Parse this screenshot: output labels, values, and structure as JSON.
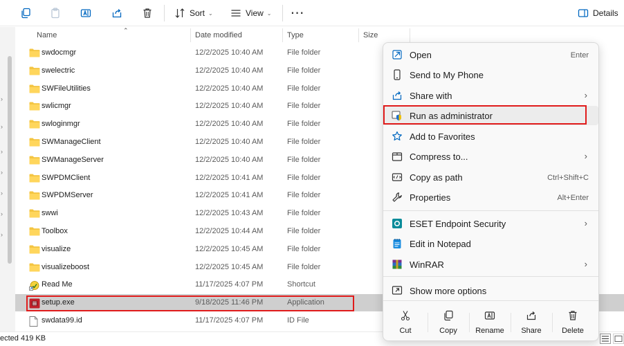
{
  "toolbar": {
    "sort_label": "Sort",
    "view_label": "View",
    "details_label": "Details",
    "icons": [
      "copy-icon",
      "paste-icon",
      "rename-icon",
      "share-icon",
      "delete-icon",
      "sort-icon",
      "view-icon",
      "more-icon",
      "details-pane-icon"
    ]
  },
  "columns": {
    "name": "Name",
    "date": "Date modified",
    "type": "Type",
    "size": "Size"
  },
  "files": [
    {
      "name": "swdocmgr",
      "date": "12/2/2025 10:40 AM",
      "type": "File folder",
      "icon": "folder"
    },
    {
      "name": "swelectric",
      "date": "12/2/2025 10:40 AM",
      "type": "File folder",
      "icon": "folder"
    },
    {
      "name": "SWFileUtilities",
      "date": "12/2/2025 10:40 AM",
      "type": "File folder",
      "icon": "folder"
    },
    {
      "name": "swlicmgr",
      "date": "12/2/2025 10:40 AM",
      "type": "File folder",
      "icon": "folder"
    },
    {
      "name": "swloginmgr",
      "date": "12/2/2025 10:40 AM",
      "type": "File folder",
      "icon": "folder"
    },
    {
      "name": "SWManageClient",
      "date": "12/2/2025 10:40 AM",
      "type": "File folder",
      "icon": "folder"
    },
    {
      "name": "SWManageServer",
      "date": "12/2/2025 10:40 AM",
      "type": "File folder",
      "icon": "folder"
    },
    {
      "name": "SWPDMClient",
      "date": "12/2/2025 10:41 AM",
      "type": "File folder",
      "icon": "folder"
    },
    {
      "name": "SWPDMServer",
      "date": "12/2/2025 10:41 AM",
      "type": "File folder",
      "icon": "folder"
    },
    {
      "name": "swwi",
      "date": "12/2/2025 10:43 AM",
      "type": "File folder",
      "icon": "folder"
    },
    {
      "name": "Toolbox",
      "date": "12/2/2025 10:44 AM",
      "type": "File folder",
      "icon": "folder"
    },
    {
      "name": "visualize",
      "date": "12/2/2025 10:45 AM",
      "type": "File folder",
      "icon": "folder"
    },
    {
      "name": "visualizeboost",
      "date": "12/2/2025 10:45 AM",
      "type": "File folder",
      "icon": "folder"
    },
    {
      "name": "Read Me",
      "date": "11/17/2025 4:07 PM",
      "type": "Shortcut",
      "icon": "shortcut"
    },
    {
      "name": "setup.exe",
      "date": "9/18/2025 11:46 PM",
      "type": "Application",
      "icon": "app",
      "selected": true
    },
    {
      "name": "swdata99.id",
      "date": "11/17/2025 4:07 PM",
      "type": "ID File",
      "icon": "file"
    }
  ],
  "status": {
    "text": "ected  419 KB"
  },
  "context_menu": {
    "items": [
      {
        "label": "Open",
        "shortcut": "Enter",
        "icon": "open-icon"
      },
      {
        "label": "Send to My Phone",
        "shortcut": "",
        "icon": "phone-icon"
      },
      {
        "label": "Share with",
        "shortcut": "",
        "icon": "share-with-icon",
        "submenu": true
      },
      {
        "label": "Run as administrator",
        "shortcut": "",
        "icon": "shield-icon",
        "highlighted": true
      },
      {
        "label": "Add to Favorites",
        "shortcut": "",
        "icon": "star-icon"
      },
      {
        "label": "Compress to...",
        "shortcut": "",
        "icon": "zip-icon",
        "submenu": true
      },
      {
        "label": "Copy as path",
        "shortcut": "Ctrl+Shift+C",
        "icon": "path-icon"
      },
      {
        "label": "Properties",
        "shortcut": "Alt+Enter",
        "icon": "wrench-icon"
      },
      {
        "label": "ESET Endpoint Security",
        "shortcut": "",
        "icon": "eset-icon",
        "submenu": true
      },
      {
        "label": "Edit in Notepad",
        "shortcut": "",
        "icon": "notepad-icon"
      },
      {
        "label": "WinRAR",
        "shortcut": "",
        "icon": "winrar-icon",
        "submenu": true
      },
      {
        "label": "Show more options",
        "shortcut": "",
        "icon": "more-options-icon"
      }
    ],
    "quick_actions": [
      {
        "label": "Cut",
        "icon": "cut-icon"
      },
      {
        "label": "Copy",
        "icon": "copy-icon"
      },
      {
        "label": "Rename",
        "icon": "rename-icon"
      },
      {
        "label": "Share",
        "icon": "share-icon"
      },
      {
        "label": "Delete",
        "icon": "delete-icon"
      }
    ]
  },
  "colors": {
    "highlight": "#e01b1b",
    "selection": "#cfcfcf",
    "folder": "#f4c542",
    "accent": "#0067c0"
  }
}
